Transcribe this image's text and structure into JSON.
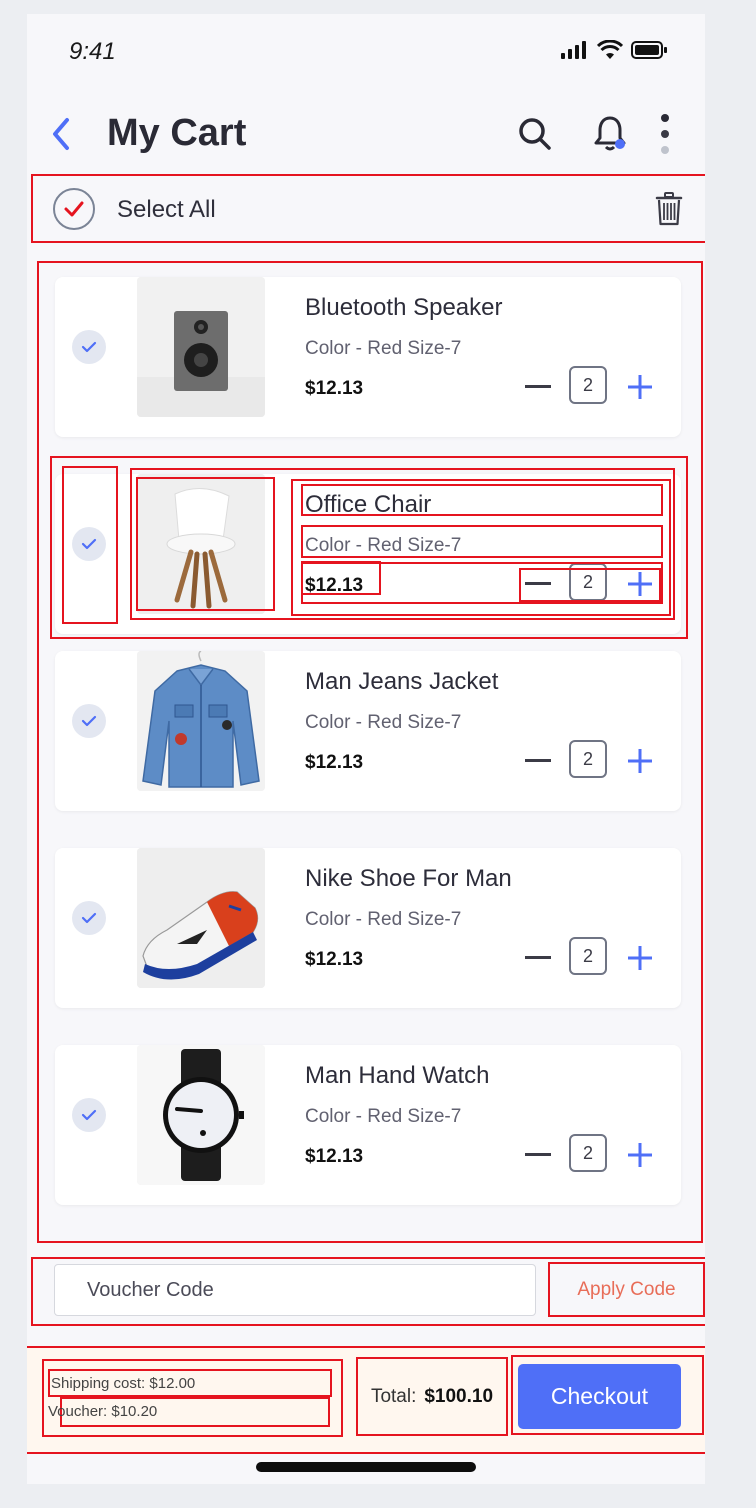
{
  "status_bar": {
    "time": "9:41"
  },
  "header": {
    "title": "My Cart"
  },
  "select_all": {
    "label": "Select All"
  },
  "cart": {
    "items": [
      {
        "name": "Bluetooth Speaker",
        "variant": "Color - Red  Size-7",
        "price": "$12.13",
        "qty": "2"
      },
      {
        "name": "Office Chair",
        "variant": "Color - Red  Size-7",
        "price": "$12.13",
        "qty": "2"
      },
      {
        "name": "Man Jeans Jacket",
        "variant": "Color - Red  Size-7",
        "price": "$12.13",
        "qty": "2"
      },
      {
        "name": "Nike Shoe For Man",
        "variant": "Color - Red  Size-7",
        "price": "$12.13",
        "qty": "2"
      },
      {
        "name": "Man Hand Watch",
        "variant": "Color - Red  Size-7",
        "price": "$12.13",
        "qty": "2"
      }
    ]
  },
  "voucher": {
    "placeholder": "Voucher Code",
    "apply_label": "Apply Code"
  },
  "summary": {
    "shipping": "Shipping cost:  $12.00",
    "voucher": "Voucher:  $10.20",
    "total_label": "Total:",
    "total_value": "$100.10",
    "checkout_label": "Checkout"
  },
  "colors": {
    "accent": "#4f6ff7",
    "danger": "#e5141f",
    "apply_text": "#e86d58"
  }
}
